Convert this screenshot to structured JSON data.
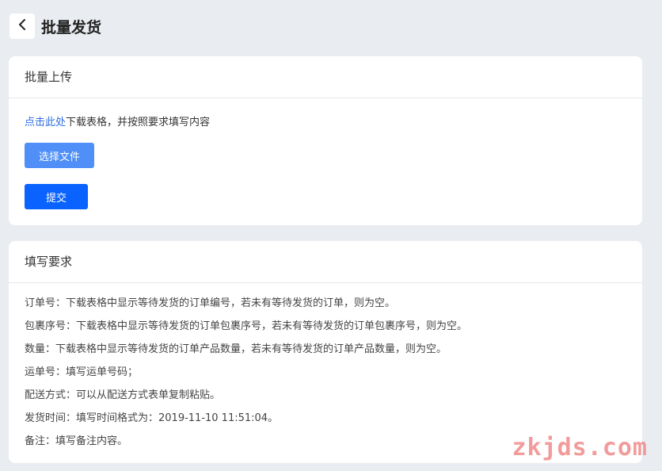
{
  "header": {
    "back_icon": "chevron-left-icon",
    "title": "批量发货"
  },
  "upload": {
    "title": "批量上传",
    "hint_link": "点击此处",
    "hint_text": "下载表格，并按照要求填写内容",
    "select_file_label": "选择文件",
    "submit_label": "提交"
  },
  "requirements": {
    "title": "填写要求",
    "items": [
      "订单号：下载表格中显示等待发货的订单编号，若未有等待发货的订单，则为空。",
      "包裹序号：下载表格中显示等待发货的订单包裹序号，若未有等待发货的订单包裹序号，则为空。",
      "数量：下载表格中显示等待发货的订单产品数量，若未有等待发货的订单产品数量，则为空。",
      "运单号：填写运单号码；",
      "配送方式：可以从配送方式表单复制粘贴。",
      "发货时间：填写时间格式为：2019-11-10 11:51:04。",
      "备注：填写备注内容。"
    ]
  },
  "watermark": "zkjds.com",
  "colors": {
    "background": "#e9ecf0",
    "link": "#2f6de1",
    "select_button": "#4f8ff7",
    "submit_button": "#0a63ff",
    "watermark": "#f08a8a"
  }
}
